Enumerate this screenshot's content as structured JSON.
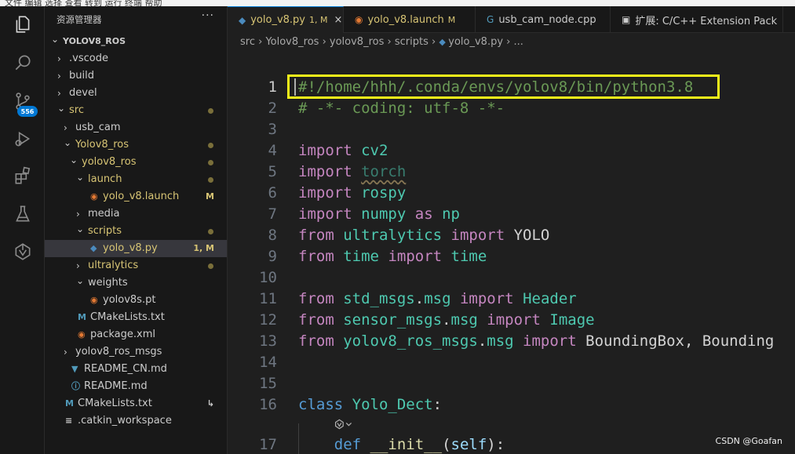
{
  "menubar": {
    "text": "文件  编辑  选择  查看  转到  运行  终端  帮助"
  },
  "activity_bar": {
    "items": [
      {
        "name": "explorer-icon"
      },
      {
        "name": "search-icon"
      },
      {
        "name": "source-control-icon"
      },
      {
        "name": "run-debug-icon"
      },
      {
        "name": "extensions-icon"
      },
      {
        "name": "testing-icon"
      },
      {
        "name": "ros-icon"
      }
    ],
    "source_control_badge": "556"
  },
  "sidebar": {
    "title": "资源管理器",
    "more": "···",
    "items": [
      {
        "label": "YOLOV8_ROS",
        "chev": "⌄",
        "bold": true
      },
      {
        "label": ".vscode",
        "chev": "›"
      },
      {
        "label": "build",
        "chev": "›"
      },
      {
        "label": "devel",
        "chev": "›"
      },
      {
        "label": "src",
        "chev": "⌄",
        "dot": true
      },
      {
        "label": "usb_cam",
        "chev": "›"
      },
      {
        "label": "Yolov8_ros",
        "chev": "⌄",
        "dot": true
      },
      {
        "label": "yolov8_ros",
        "chev": "⌄",
        "dot": true
      },
      {
        "label": "launch",
        "chev": "⌄",
        "dot": true
      },
      {
        "label": "yolo_v8.launch",
        "icon": "rss-icon",
        "deco": "M"
      },
      {
        "label": "media",
        "chev": "›"
      },
      {
        "label": "scripts",
        "chev": "⌄",
        "dot": true
      },
      {
        "label": "yolo_v8.py",
        "icon": "python-icon",
        "deco": "1, M",
        "selected": true
      },
      {
        "label": "ultralytics",
        "chev": "›",
        "dot": true
      },
      {
        "label": "weights",
        "chev": "⌄"
      },
      {
        "label": "yolov8s.pt",
        "icon": "rss-icon"
      },
      {
        "label": "CMakeLists.txt",
        "icon": "cmake-icon"
      },
      {
        "label": "package.xml",
        "icon": "rss-icon"
      },
      {
        "label": "yolov8_ros_msgs",
        "chev": "›"
      },
      {
        "label": "README_CN.md",
        "icon": "markdown-icon"
      },
      {
        "label": "README.md",
        "icon": "info-icon"
      },
      {
        "label": "CMakeLists.txt",
        "icon": "cmake-icon",
        "deco": "↳"
      },
      {
        "label": ".catkin_workspace",
        "icon": "lines-icon"
      }
    ]
  },
  "tabs": [
    {
      "label": "yolo_v8.py",
      "deco": "1, M",
      "icon": "python-icon",
      "active": true
    },
    {
      "label": "yolo_v8.launch",
      "deco": "M",
      "icon": "rss-icon"
    },
    {
      "label": "usb_cam_node.cpp",
      "icon": "cpp-icon"
    },
    {
      "label": "扩展: C/C++ Extension Pack",
      "icon": "extension-tab-icon"
    }
  ],
  "breadcrumb": {
    "parts": [
      "src",
      "Yolov8_ros",
      "yolov8_ros",
      "scripts",
      "yolo_v8.py",
      "..."
    ]
  },
  "code": {
    "lines": [
      {
        "n": "1",
        "tokens": [
          {
            "t": "#!/home/hhh/.conda/envs/yolov8/bin/python3.8",
            "c": "cmt"
          }
        ]
      },
      {
        "n": "2",
        "tokens": [
          {
            "t": "# -*- coding: utf-8 -*-",
            "c": "cmt"
          }
        ]
      },
      {
        "n": "3",
        "tokens": []
      },
      {
        "n": "4",
        "tokens": [
          {
            "t": "import",
            "c": "kw-import"
          },
          {
            "t": " "
          },
          {
            "t": "cv2",
            "c": "mod"
          }
        ]
      },
      {
        "n": "5",
        "tokens": [
          {
            "t": "import",
            "c": "kw-import"
          },
          {
            "t": " "
          },
          {
            "t": "torch",
            "c": "torch"
          }
        ]
      },
      {
        "n": "6",
        "tokens": [
          {
            "t": "import",
            "c": "kw-import"
          },
          {
            "t": " "
          },
          {
            "t": "rospy",
            "c": "mod"
          }
        ]
      },
      {
        "n": "7",
        "tokens": [
          {
            "t": "import",
            "c": "kw-import"
          },
          {
            "t": " "
          },
          {
            "t": "numpy",
            "c": "mod"
          },
          {
            "t": " "
          },
          {
            "t": "as",
            "c": "kw-import"
          },
          {
            "t": " "
          },
          {
            "t": "np",
            "c": "mod"
          }
        ]
      },
      {
        "n": "8",
        "tokens": [
          {
            "t": "from",
            "c": "kw-import"
          },
          {
            "t": " "
          },
          {
            "t": "ultralytics",
            "c": "mod"
          },
          {
            "t": " "
          },
          {
            "t": "import",
            "c": "kw-import"
          },
          {
            "t": " "
          },
          {
            "t": "YOLO",
            "c": "plain"
          }
        ]
      },
      {
        "n": "9",
        "tokens": [
          {
            "t": "from",
            "c": "kw-import"
          },
          {
            "t": " "
          },
          {
            "t": "time",
            "c": "mod"
          },
          {
            "t": " "
          },
          {
            "t": "import",
            "c": "kw-import"
          },
          {
            "t": " "
          },
          {
            "t": "time",
            "c": "mod"
          }
        ]
      },
      {
        "n": "10",
        "tokens": []
      },
      {
        "n": "11",
        "tokens": [
          {
            "t": "from",
            "c": "kw-import"
          },
          {
            "t": " "
          },
          {
            "t": "std_msgs",
            "c": "mod"
          },
          {
            "t": ".",
            "c": "plain"
          },
          {
            "t": "msg",
            "c": "mod"
          },
          {
            "t": " "
          },
          {
            "t": "import",
            "c": "kw-import"
          },
          {
            "t": " "
          },
          {
            "t": "Header",
            "c": "mod"
          }
        ]
      },
      {
        "n": "12",
        "tokens": [
          {
            "t": "from",
            "c": "kw-import"
          },
          {
            "t": " "
          },
          {
            "t": "sensor_msgs",
            "c": "mod"
          },
          {
            "t": ".",
            "c": "plain"
          },
          {
            "t": "msg",
            "c": "mod"
          },
          {
            "t": " "
          },
          {
            "t": "import",
            "c": "kw-import"
          },
          {
            "t": " "
          },
          {
            "t": "Image",
            "c": "mod"
          }
        ]
      },
      {
        "n": "13",
        "tokens": [
          {
            "t": "from",
            "c": "kw-import"
          },
          {
            "t": " "
          },
          {
            "t": "yolov8_ros_msgs",
            "c": "mod"
          },
          {
            "t": ".",
            "c": "plain"
          },
          {
            "t": "msg",
            "c": "mod"
          },
          {
            "t": " "
          },
          {
            "t": "import",
            "c": "kw-import"
          },
          {
            "t": " "
          },
          {
            "t": "BoundingBox, Bounding",
            "c": "plain"
          }
        ]
      },
      {
        "n": "14",
        "tokens": []
      },
      {
        "n": "15",
        "tokens": []
      },
      {
        "n": "16",
        "tokens": [
          {
            "t": "class",
            "c": "kw-def"
          },
          {
            "t": " "
          },
          {
            "t": "Yolo_Dect",
            "c": "mod"
          },
          {
            "t": ":",
            "c": "plain"
          }
        ]
      },
      {
        "n": "",
        "tokens": []
      },
      {
        "n": "17",
        "tokens": [
          {
            "t": "    "
          },
          {
            "t": "def",
            "c": "kw-def"
          },
          {
            "t": " "
          },
          {
            "t": "__init__",
            "c": "fn"
          },
          {
            "t": "(",
            "c": "plain"
          },
          {
            "t": "self",
            "c": "param"
          },
          {
            "t": "):",
            "c": "plain"
          }
        ]
      }
    ]
  },
  "watermark": "CSDN @Goafan"
}
